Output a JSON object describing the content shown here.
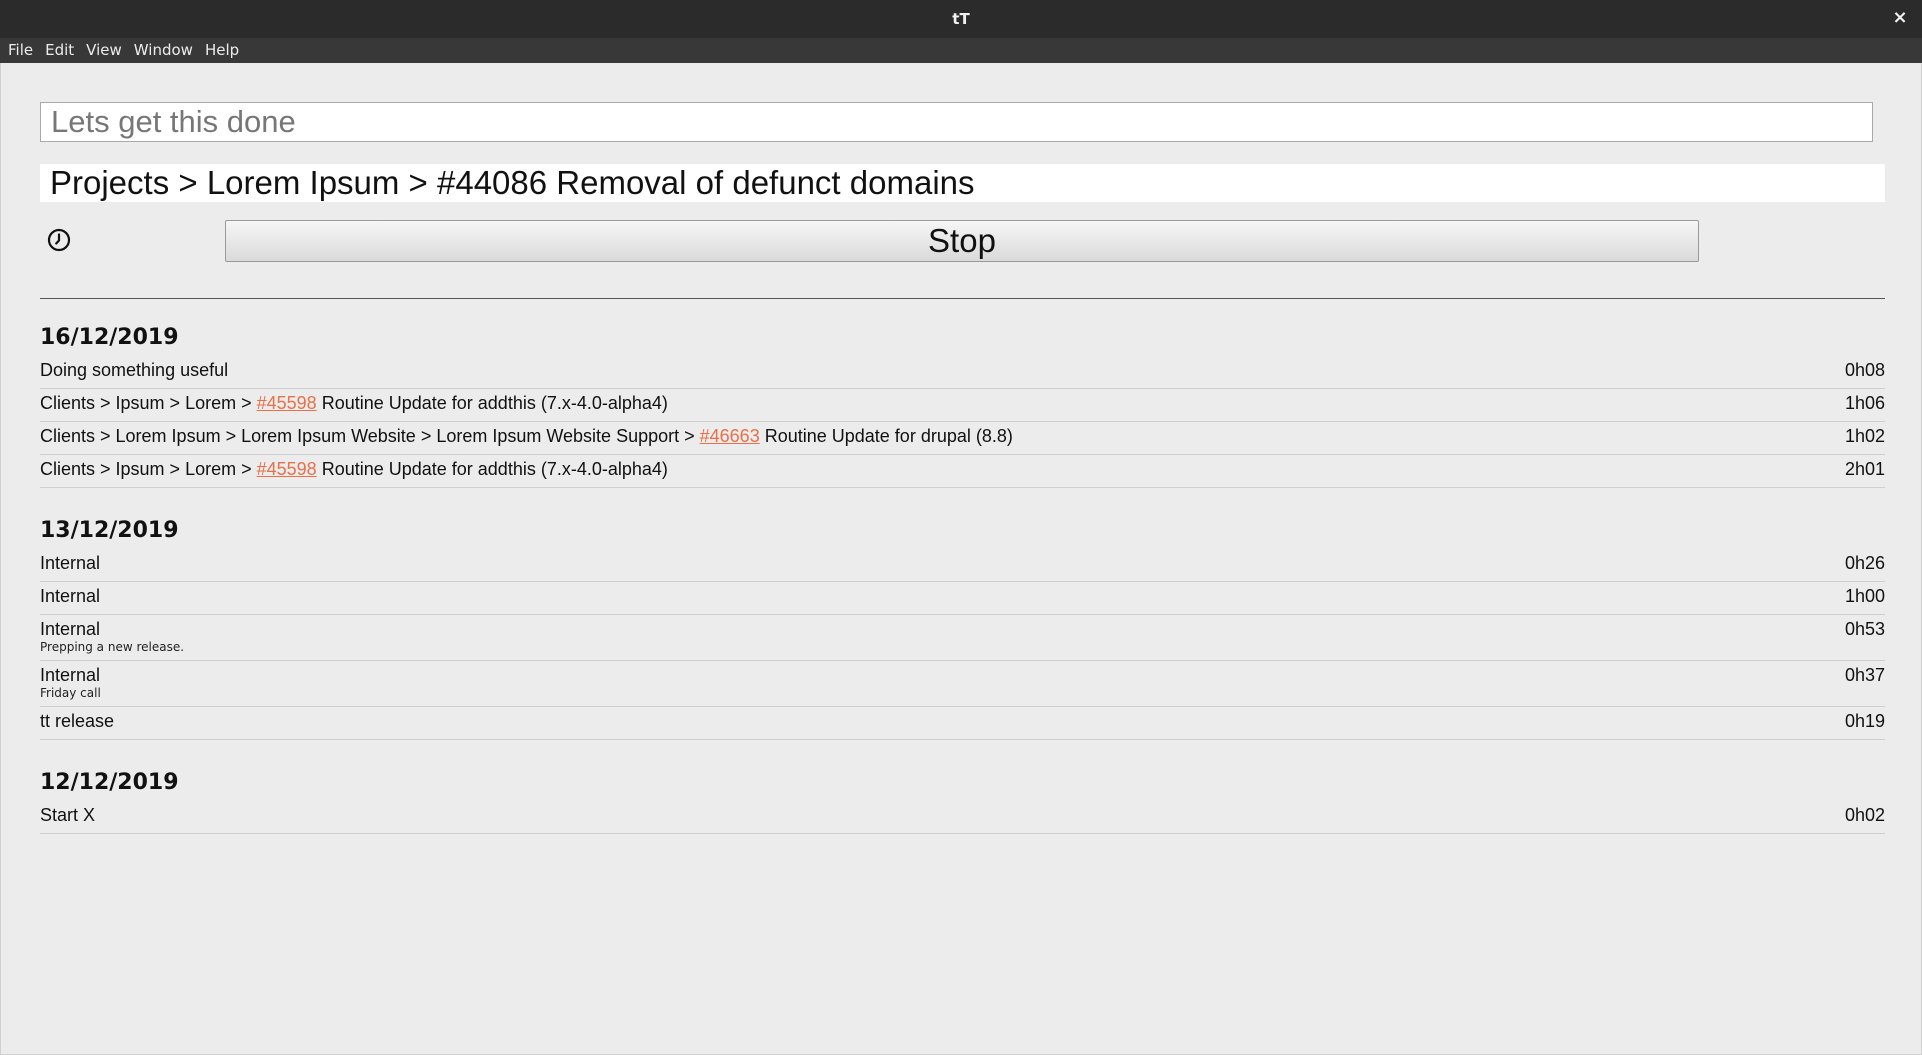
{
  "window": {
    "title": "tT",
    "close_glyph": "×"
  },
  "menu": [
    "File",
    "Edit",
    "View",
    "Window",
    "Help"
  ],
  "task_input": {
    "placeholder": "Lets get this done",
    "value": ""
  },
  "current_task": {
    "text": "Projects > Lorem Ipsum > #44086 Removal of defunct domains"
  },
  "clock_icon": "clock-icon",
  "stop_button": {
    "label": "Stop"
  },
  "link_color": "#e8714a",
  "days": [
    {
      "date": "16/12/2019",
      "entries": [
        {
          "prefix": "Doing something useful",
          "link": "",
          "suffix": "",
          "note": "",
          "duration": "0h08"
        },
        {
          "prefix": "Clients > Ipsum > Lorem > ",
          "link": "#45598",
          "suffix": " Routine Update for addthis (7.x-4.0-alpha4)",
          "note": "",
          "duration": "1h06"
        },
        {
          "prefix": "Clients > Lorem Ipsum > Lorem Ipsum Website > Lorem Ipsum Website Support > ",
          "link": "#46663",
          "suffix": " Routine Update for drupal (8.8)",
          "note": "",
          "duration": "1h02"
        },
        {
          "prefix": "Clients > Ipsum > Lorem > ",
          "link": "#45598",
          "suffix": " Routine Update for addthis (7.x-4.0-alpha4)",
          "note": "",
          "duration": "2h01"
        }
      ]
    },
    {
      "date": "13/12/2019",
      "entries": [
        {
          "prefix": "Internal",
          "link": "",
          "suffix": "",
          "note": "",
          "duration": "0h26"
        },
        {
          "prefix": "Internal",
          "link": "",
          "suffix": "",
          "note": "",
          "duration": "1h00"
        },
        {
          "prefix": "Internal",
          "link": "",
          "suffix": "",
          "note": "Prepping a new release.",
          "duration": "0h53"
        },
        {
          "prefix": "Internal",
          "link": "",
          "suffix": "",
          "note": "Friday call",
          "duration": "0h37"
        },
        {
          "prefix": "tt release",
          "link": "",
          "suffix": "",
          "note": "",
          "duration": "0h19"
        }
      ]
    },
    {
      "date": "12/12/2019",
      "entries": [
        {
          "prefix": "Start X",
          "link": "",
          "suffix": "",
          "note": "",
          "duration": "0h02"
        }
      ]
    }
  ]
}
